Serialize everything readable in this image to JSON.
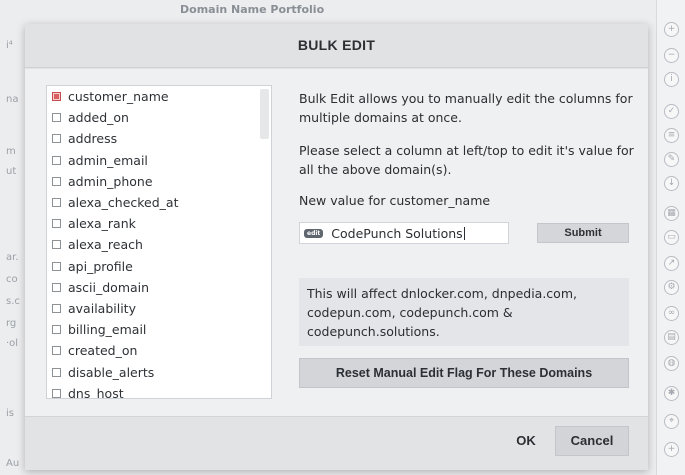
{
  "background": {
    "title": "Domain Name Portfolio",
    "left_fragments": [
      "i⁴",
      "na",
      "m",
      "ut",
      "ar.",
      "co",
      "s.c",
      "rg",
      "·ol",
      "is",
      "Au"
    ]
  },
  "modal": {
    "title": "BULK EDIT",
    "columns": [
      {
        "label": "customer_name",
        "checked": true
      },
      {
        "label": "added_on",
        "checked": false
      },
      {
        "label": "address",
        "checked": false
      },
      {
        "label": "admin_email",
        "checked": false
      },
      {
        "label": "admin_phone",
        "checked": false
      },
      {
        "label": "alexa_checked_at",
        "checked": false
      },
      {
        "label": "alexa_rank",
        "checked": false
      },
      {
        "label": "alexa_reach",
        "checked": false
      },
      {
        "label": "api_profile",
        "checked": false
      },
      {
        "label": "ascii_domain",
        "checked": false
      },
      {
        "label": "availability",
        "checked": false
      },
      {
        "label": "billing_email",
        "checked": false
      },
      {
        "label": "created_on",
        "checked": false
      },
      {
        "label": "disable_alerts",
        "checked": false
      },
      {
        "label": "dns_host",
        "checked": false
      }
    ],
    "intro": "Bulk Edit allows you to manually edit the columns for multiple domains at once.",
    "instruction": "Please select a column at left/top to edit it's value for all the above domain(s).",
    "new_value_label": "New value for customer_name",
    "edit_badge": "edit",
    "input_value": "CodePunch Solutions",
    "submit_label": "Submit",
    "affect_text": "This will affect dnlocker.com, dnpedia.com, codepun.com, codepunch.com & codepunch.solutions.",
    "reset_label": "Reset Manual Edit Flag For These Domains",
    "ok_label": "OK",
    "cancel_label": "Cancel"
  },
  "toolbar_icons": [
    "plus-icon",
    "minus-icon",
    "info-icon",
    "check-icon",
    "list-icon",
    "edit-icon",
    "download-icon",
    "grid-icon",
    "folder-icon",
    "export-icon",
    "settings-icon",
    "link-icon",
    "table-icon",
    "globe-icon",
    "gear-icon",
    "tag-icon",
    "add-icon"
  ]
}
